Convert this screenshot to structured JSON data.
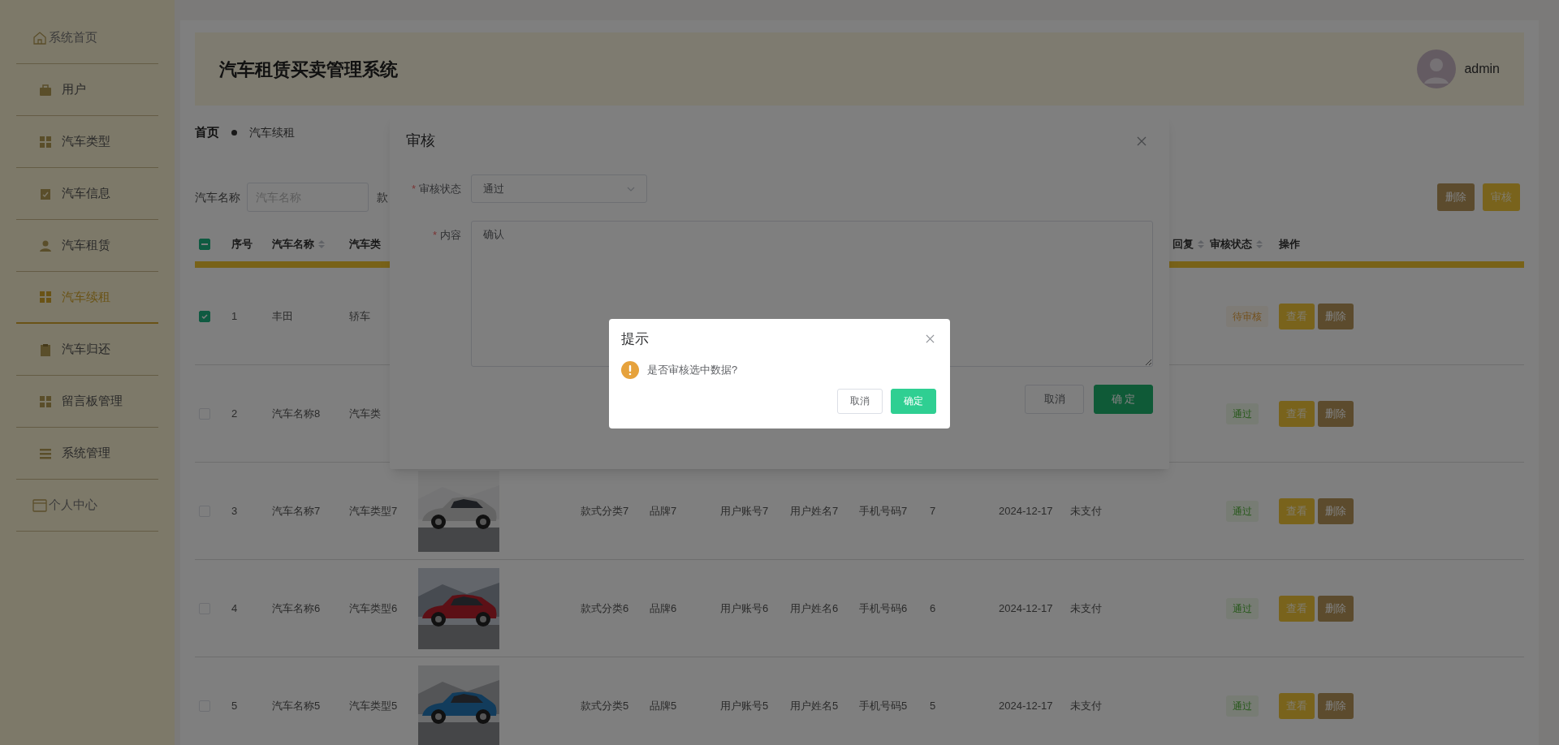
{
  "sidebar": {
    "items": [
      {
        "label": "系统首页",
        "kind": "link",
        "selected": false
      },
      {
        "label": "用户",
        "kind": "menu",
        "selected": false
      },
      {
        "label": "汽车类型",
        "kind": "menu",
        "selected": false
      },
      {
        "label": "汽车信息",
        "kind": "menu",
        "selected": false
      },
      {
        "label": "汽车租赁",
        "kind": "menu",
        "selected": false
      },
      {
        "label": "汽车续租",
        "kind": "menu",
        "selected": true
      },
      {
        "label": "汽车归还",
        "kind": "menu",
        "selected": false
      },
      {
        "label": "留言板管理",
        "kind": "menu",
        "selected": false
      },
      {
        "label": "系统管理",
        "kind": "menu",
        "selected": false
      },
      {
        "label": "个人中心",
        "kind": "link",
        "selected": false
      }
    ]
  },
  "header": {
    "title": "汽车租赁买卖管理系统",
    "user": "admin"
  },
  "breadcrumb": [
    "首页",
    "汽车续租"
  ],
  "search": {
    "label": "汽车名称",
    "placeholder": "汽车名称",
    "next_label": "款"
  },
  "toolbar": [
    {
      "label": "删除",
      "kind": "delete"
    },
    {
      "label": "审核",
      "kind": "review"
    }
  ],
  "table": {
    "select_all": {
      "checked": true,
      "indeterminate": true
    },
    "columns": [
      {
        "label": "序号",
        "sortable": false
      },
      {
        "label": "汽车名称",
        "sortable": true
      },
      {
        "label": "汽车类",
        "sortable": false
      },
      {
        "label": "回复",
        "sortable": true
      },
      {
        "label": "审核状态",
        "sortable": true
      },
      {
        "label": "操作",
        "sortable": false
      }
    ],
    "rows": [
      {
        "selected": true,
        "index": "1",
        "car_name": "丰田",
        "car_type": "轿车",
        "status": {
          "text": "待审核",
          "kind": "pending"
        },
        "actions": [
          {
            "label": "查看",
            "kind": "view"
          },
          {
            "label": "删除",
            "kind": "delete"
          }
        ]
      },
      {
        "selected": false,
        "index": "2",
        "car_name": "汽车名称8",
        "car_type": "汽车类",
        "status": {
          "text": "通过",
          "kind": "approved"
        },
        "actions": [
          {
            "label": "查看",
            "kind": "view"
          },
          {
            "label": "删除",
            "kind": "delete"
          }
        ]
      },
      {
        "selected": false,
        "index": "3",
        "car_name": "汽车名称7",
        "car_type": "汽车类型7",
        "style": "款式分类7",
        "brand": "品牌7",
        "account": "用户账号7",
        "user_name": "用户姓名7",
        "phone": "手机号码7",
        "number": "7",
        "date": "2024-12-17",
        "payment": "未支付",
        "status": {
          "text": "通过",
          "kind": "approved"
        },
        "actions": [
          {
            "label": "查看",
            "kind": "view"
          },
          {
            "label": "删除",
            "kind": "delete"
          }
        ]
      },
      {
        "selected": false,
        "index": "4",
        "car_name": "汽车名称6",
        "car_type": "汽车类型6",
        "style": "款式分类6",
        "brand": "品牌6",
        "account": "用户账号6",
        "user_name": "用户姓名6",
        "phone": "手机号码6",
        "number": "6",
        "date": "2024-12-17",
        "payment": "未支付",
        "status": {
          "text": "通过",
          "kind": "approved"
        },
        "actions": [
          {
            "label": "查看",
            "kind": "view"
          },
          {
            "label": "删除",
            "kind": "delete"
          }
        ]
      },
      {
        "selected": false,
        "index": "5",
        "car_name": "汽车名称5",
        "car_type": "汽车类型5",
        "style": "款式分类5",
        "brand": "品牌5",
        "account": "用户账号5",
        "user_name": "用户姓名5",
        "phone": "手机号码5",
        "number": "5",
        "date": "2024-12-17",
        "payment": "未支付",
        "status": {
          "text": "通过",
          "kind": "approved"
        },
        "actions": [
          {
            "label": "查看",
            "kind": "view"
          },
          {
            "label": "删除",
            "kind": "delete"
          }
        ]
      }
    ]
  },
  "review_dialog": {
    "title": "审核",
    "fields": [
      {
        "label": "审核状态",
        "required_mark": "*",
        "kind": "select",
        "value": "通过"
      },
      {
        "label": "内容",
        "required_mark": "*",
        "kind": "textarea",
        "value": "确认"
      }
    ],
    "buttons": [
      {
        "label": "取消",
        "kind": "secondary"
      },
      {
        "label": "确 定",
        "kind": "primary"
      }
    ]
  },
  "message_box": {
    "title": "提示",
    "message": "是否审核选中数据?",
    "buttons": [
      {
        "label": "取消",
        "kind": "secondary"
      },
      {
        "label": "确定",
        "kind": "primary"
      }
    ]
  }
}
